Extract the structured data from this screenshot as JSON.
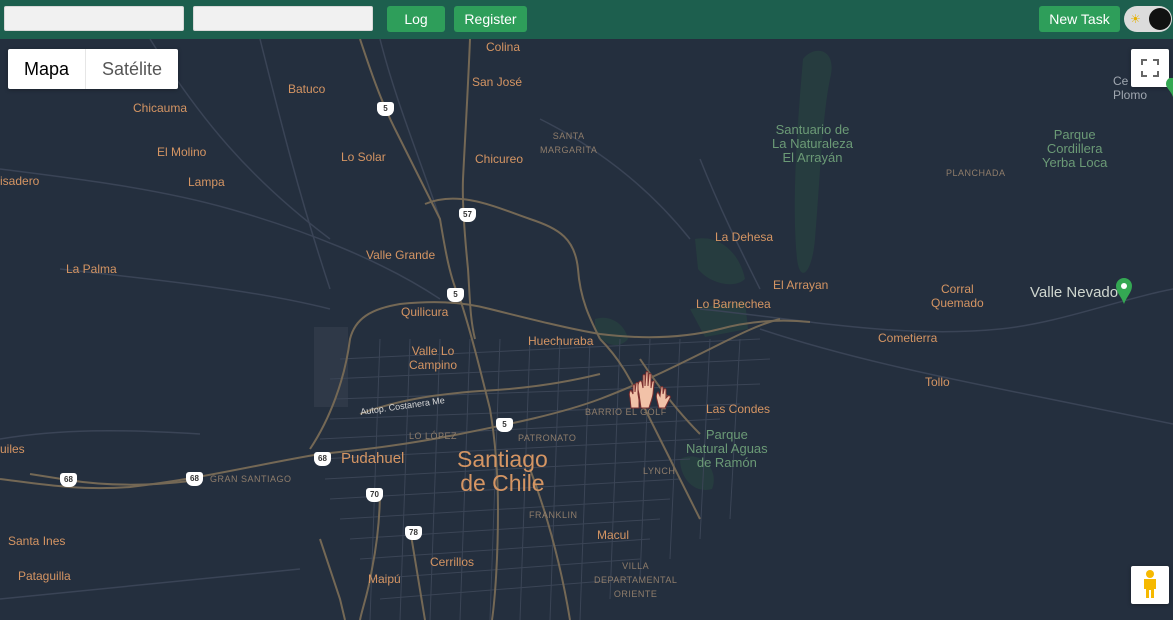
{
  "header": {
    "username_value": "",
    "password_value": "",
    "login_label": "Log in",
    "register_label": "Register",
    "new_task_label": "New Task",
    "theme_toggle": {
      "state": "dark",
      "icon": "sun-icon"
    }
  },
  "map": {
    "map_type": {
      "options": [
        "Mapa",
        "Satélite"
      ],
      "selected": "Mapa"
    },
    "controls": {
      "fullscreen_icon": "fullscreen-icon",
      "pegman_icon": "pegman-icon"
    },
    "marker_icon": "raised-hands-icon",
    "labels": {
      "colina": "Colina",
      "san_jose": "San José",
      "batuco": "Batuco",
      "chicauma": "Chicauma",
      "el_molino": "El Molino",
      "lo_solar": "Lo Solar",
      "chicureo": "Chicureo",
      "santa_margarita": "SANTA\nMARGARITA",
      "santuario": "Santuario de\nLa Naturaleza\nEl Arrayán",
      "parque_cordillera": "Parque\nCordillera\nYerba Loca",
      "planchada": "PLANCHADA",
      "ce_plomo": "Ce\nPlomo",
      "isadero": "isadero",
      "lampa": "Lampa",
      "la_dehesa": "La Dehesa",
      "valle_grande": "Valle Grande",
      "la_palma": "La Palma",
      "el_arrayan": "El Arrayan",
      "corral_quemado": "Corral\nQuemado",
      "valle_nevado": "Valle Nevado",
      "lo_barnechea": "Lo Barnechea",
      "quilicura": "Quilicura",
      "huechuraba": "Huechuraba",
      "comet": "Cometierra",
      "valle_lo_campino": "Valle Lo\nCampino",
      "tollo": "Tollo",
      "autop": "Autop. Costanera Me",
      "barrio_el_golf": "BARRIO EL GOLF",
      "las_condes": "Las Condes",
      "lo_lopez": "LO LÓPEZ",
      "patronato": "PATRONATO",
      "parque_aguas": "Parque\nNatural Aguas\nde Ramón",
      "uiles": "uiles",
      "pudahuel": "Pudahuel",
      "santiago": "Santiago\nde Chile",
      "gran_santiago": "GRAN SANTIAGO",
      "lynch": "LYNCH",
      "franklin": "FRANKLIN",
      "santa_ines": "Santa Ines",
      "macul": "Macul",
      "cerrillos": "Cerrillos",
      "villa": "VILLA\nDEPARTAMENTAL\nORIENTE",
      "pataguilla": "Pataguilla",
      "maipu": "Maipú"
    },
    "shields": {
      "r5a": "5",
      "r57": "57",
      "r5b": "5",
      "r5c": "5",
      "r68a": "68",
      "r68b": "68",
      "r68c": "68",
      "r70": "70",
      "r78": "78"
    }
  }
}
